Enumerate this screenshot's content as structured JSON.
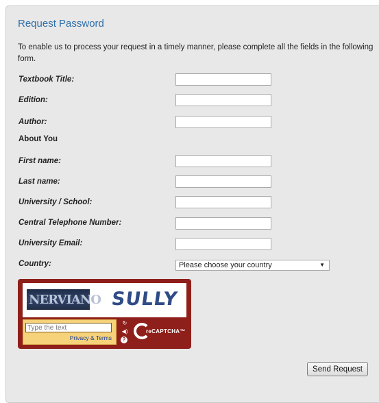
{
  "form": {
    "title": "Request Password",
    "intro": "To enable us to process your request in a timely manner, please complete all the fields in the following form.",
    "fields": {
      "textbook_title": {
        "label": "Textbook Title:",
        "value": ""
      },
      "edition": {
        "label": "Edition:",
        "value": ""
      },
      "author": {
        "label": "Author:",
        "value": ""
      },
      "first_name": {
        "label": "First name:",
        "value": ""
      },
      "last_name": {
        "label": "Last name:",
        "value": ""
      },
      "university": {
        "label": "University / School:",
        "value": ""
      },
      "phone": {
        "label": "Central Telephone Number:",
        "value": ""
      },
      "email": {
        "label": "University Email:",
        "value": ""
      }
    },
    "about_you": "About You",
    "country": {
      "label": "Country:",
      "selected": "Please choose your country"
    },
    "captcha": {
      "word1": "NERVIANO",
      "word2": "SULLY",
      "placeholder": "Type the text",
      "privacy_link": "Privacy & Terms",
      "brand": "reCAPTCHA™"
    },
    "submit_label": "Send Request"
  }
}
